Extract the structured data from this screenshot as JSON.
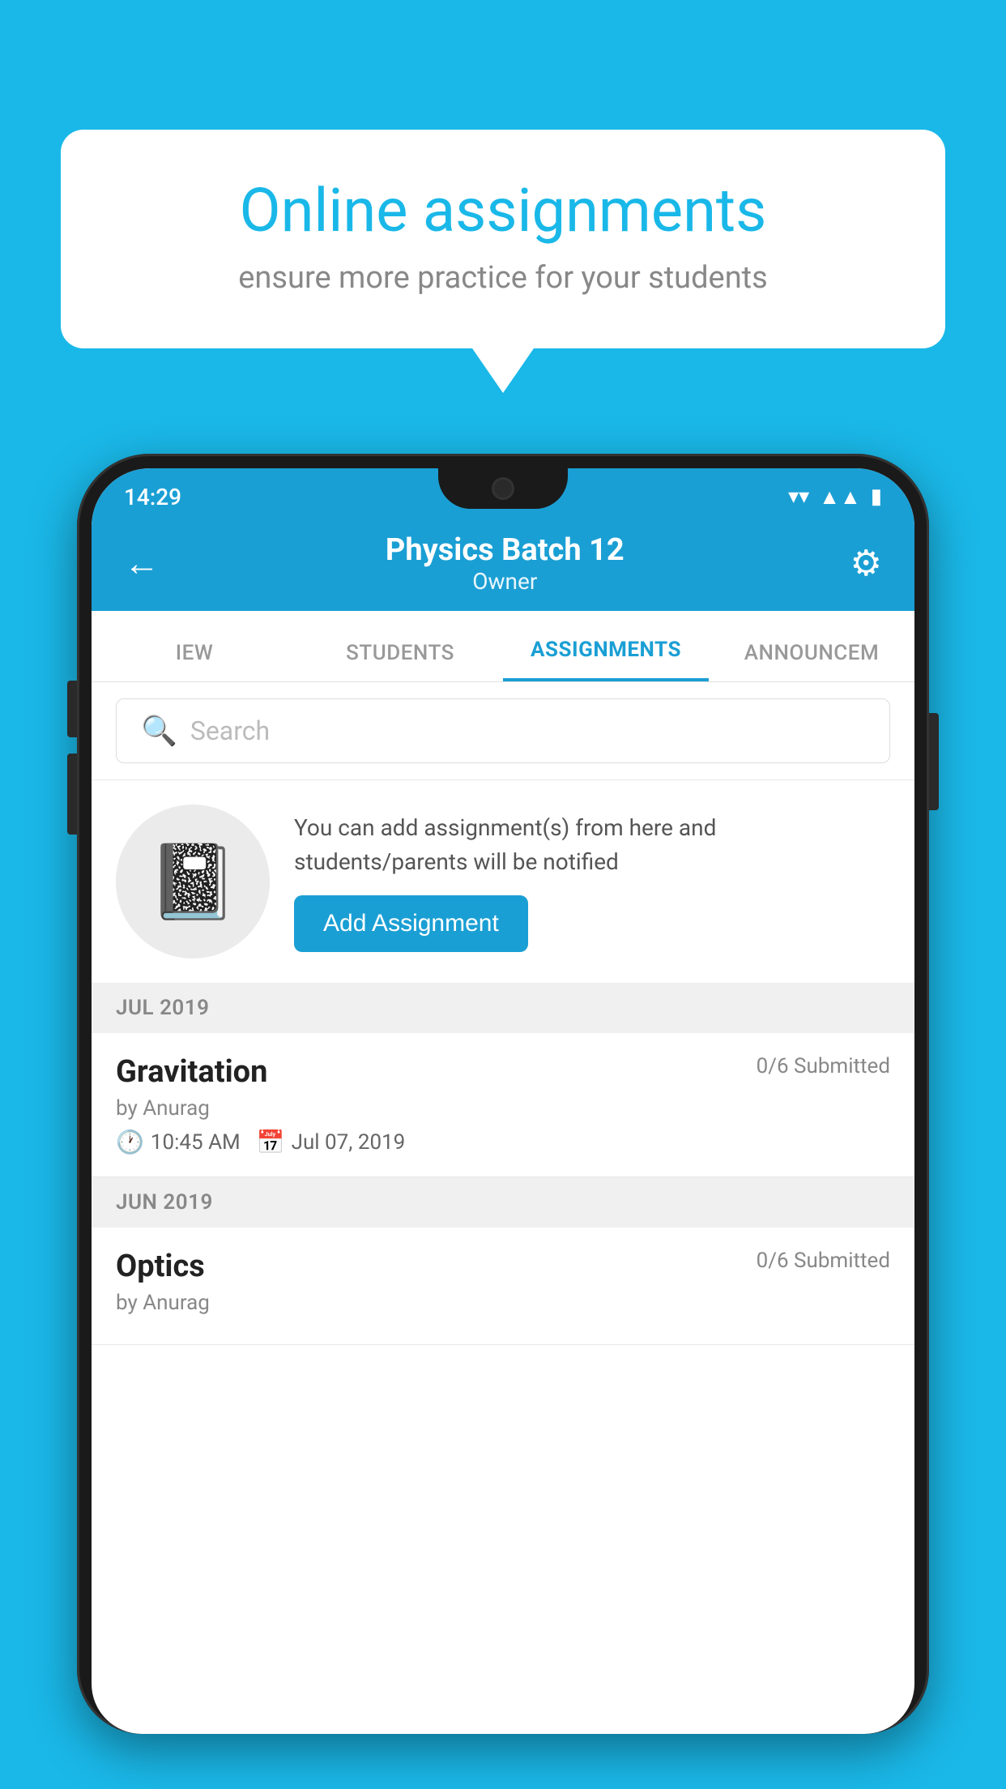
{
  "background_color": "#1ab8e8",
  "speech_bubble": {
    "title": "Online assignments",
    "subtitle": "ensure more practice for your students"
  },
  "status_bar": {
    "time": "14:29",
    "icons": [
      "wifi",
      "signal",
      "battery"
    ]
  },
  "header": {
    "title": "Physics Batch 12",
    "subtitle": "Owner",
    "back_label": "←",
    "settings_label": "⚙"
  },
  "tabs": [
    {
      "label": "IEW",
      "active": false
    },
    {
      "label": "STUDENTS",
      "active": false
    },
    {
      "label": "ASSIGNMENTS",
      "active": true
    },
    {
      "label": "ANNOUNCEM",
      "active": false
    }
  ],
  "search": {
    "placeholder": "Search"
  },
  "info_section": {
    "description": "You can add assignment(s) from here and students/parents will be notified",
    "button_label": "Add Assignment"
  },
  "sections": [
    {
      "month": "JUL 2019",
      "assignments": [
        {
          "title": "Gravitation",
          "submitted": "0/6 Submitted",
          "by": "by Anurag",
          "time": "10:45 AM",
          "date": "Jul 07, 2019"
        }
      ]
    },
    {
      "month": "JUN 2019",
      "assignments": [
        {
          "title": "Optics",
          "submitted": "0/6 Submitted",
          "by": "by Anurag",
          "time": "",
          "date": ""
        }
      ]
    }
  ]
}
